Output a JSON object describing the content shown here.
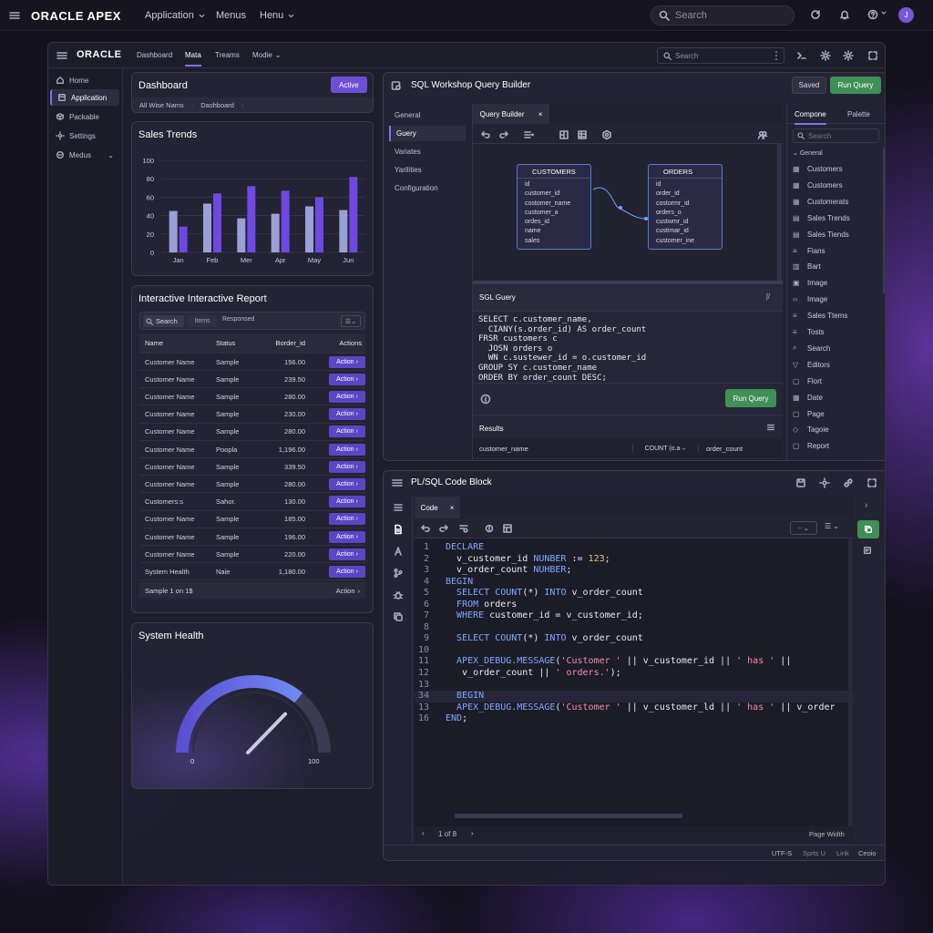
{
  "topbar": {
    "brand": "ORACLE APEX",
    "menus": [
      "Application",
      "Menus",
      "Henu"
    ],
    "search_placeholder": "Search",
    "avatar": "J"
  },
  "frame_header": {
    "brand": "ORACLE",
    "links": [
      "Dashboard",
      "Mata",
      "Treams",
      "Modie"
    ],
    "active_link": "Mata",
    "search_placeholder": "Search"
  },
  "sidebar": {
    "items": [
      {
        "label": "Home",
        "icon": "home-icon"
      },
      {
        "label": "Application",
        "icon": "app-icon"
      },
      {
        "label": "Packable",
        "icon": "package-icon"
      },
      {
        "label": "Settings",
        "icon": "gear-icon"
      },
      {
        "label": "Medus",
        "icon": "menu-icon"
      }
    ],
    "active": "Application"
  },
  "dashboard": {
    "title": "Dashboard",
    "badge": "Active",
    "breadcrumb": [
      "All Wise Nams",
      "Dashboard"
    ]
  },
  "sales_trends": {
    "title": "Sales Trends"
  },
  "chart_data": {
    "type": "bar",
    "categories": [
      "Jan",
      "Feb",
      "Mer",
      "Apr",
      "May",
      "Jun"
    ],
    "series": [
      {
        "values": [
          45,
          53,
          37,
          42,
          50,
          46
        ],
        "color": "#9aa0d6"
      },
      {
        "values": [
          28,
          64,
          72,
          67,
          60,
          82
        ],
        "color": "#6e48e0"
      }
    ],
    "title": "Sales Trends",
    "xlabel": "",
    "ylabel": "",
    "ylim": [
      0,
      100
    ],
    "yticks": [
      0,
      20,
      40,
      60,
      80,
      100
    ],
    "grid": true
  },
  "report": {
    "title": "Interactive Interactive Report",
    "search_label": "Search",
    "tabs": [
      "Items",
      "Responsed"
    ],
    "columns": [
      "Name",
      "Status",
      "Border_id",
      "Actions"
    ],
    "rows": [
      [
        "Customer Name",
        "Sample",
        "156.00",
        "Action"
      ],
      [
        "Customer Name",
        "Sample",
        "239.50",
        "Action"
      ],
      [
        "Customer Name",
        "Sample",
        "280.00",
        "Action"
      ],
      [
        "Customer Name",
        "Sample",
        "230.00",
        "Action"
      ],
      [
        "Customer Name",
        "Sample",
        "280.00",
        "Action"
      ],
      [
        "Customer Name",
        "Poopla",
        "1,196.00",
        "Action"
      ],
      [
        "Customer Name",
        "Sample",
        "339.50",
        "Action"
      ],
      [
        "Customer Name",
        "Sample",
        "280.00",
        "Action"
      ],
      [
        "Customers:s",
        "Sahor.",
        "130.00",
        "Action"
      ],
      [
        "Customer Name",
        "Sample",
        "185.00",
        "Action"
      ],
      [
        "Customer Name",
        "Sample",
        "196.00",
        "Action"
      ],
      [
        "Customer Name",
        "Sample",
        "220.00",
        "Action"
      ],
      [
        "System Health",
        "Naie",
        "1,180.00",
        "Action"
      ]
    ],
    "footer_left": "Sample 1 on 1$",
    "footer_right": "Action"
  },
  "system_health": {
    "title": "System Health",
    "min": "0",
    "max": "100",
    "gauge_value": 0.72
  },
  "query_builder": {
    "title": "SQL Workshop Query Builder",
    "saved": "Saved",
    "run": "Run Query",
    "nav": [
      "General",
      "Guery",
      "Variates",
      "Yarilities",
      "Configuration"
    ],
    "active_nav": "Guery",
    "tab": "Query Builder",
    "table1": {
      "name": "CUSTOMERS",
      "fields": [
        "id",
        "customer_id",
        "costomer_name",
        "customer_a",
        "ordes_id",
        "name",
        "sales"
      ]
    },
    "table2": {
      "name": "ORDERS",
      "fields": [
        "id",
        "order_id",
        "costormr_id",
        "orders_o",
        "custwmr_id",
        "custimar_id",
        "customer_ine"
      ]
    },
    "sql_title": "SGL Guery",
    "sql": [
      "SELECT c.customer_name,",
      "  CIANY(s.order_id) AS order_count",
      "FRSR customers c",
      "  JOSN orders o",
      "  WN c.sustewer_id = o.customer_id",
      "GROUP SY c.customer_name",
      "ORDER BY order_count DESC;"
    ],
    "run2": "Run Query",
    "results_title": "Results",
    "results_cols": [
      "customer_name",
      "COUNT (o.a→",
      "order_count"
    ]
  },
  "components": {
    "tabs": [
      "Compone",
      "Palette"
    ],
    "search_placeholder": "Search",
    "group": "General",
    "items": [
      {
        "label": "Customers",
        "icon": "table-icon"
      },
      {
        "label": "Customers",
        "icon": "table-icon"
      },
      {
        "label": "Customerats",
        "icon": "table-icon"
      },
      {
        "label": "Sales Trends",
        "icon": "chart-icon"
      },
      {
        "label": "Sales Tiends",
        "icon": "chart-icon"
      },
      {
        "label": "Fians",
        "icon": "list-icon"
      },
      {
        "label": "Bart",
        "icon": "bar-icon"
      },
      {
        "label": "Image",
        "icon": "image-icon"
      },
      {
        "label": "Image",
        "icon": "code-icon"
      },
      {
        "label": "Sales Ttems",
        "icon": "list-icon"
      },
      {
        "label": "Tosts",
        "icon": "list-icon"
      },
      {
        "label": "Search",
        "icon": "search-icon"
      },
      {
        "label": "Editors",
        "icon": "filter-icon"
      },
      {
        "label": "Flort",
        "icon": "doc-icon"
      },
      {
        "label": "Date",
        "icon": "calendar-icon"
      },
      {
        "label": "Page",
        "icon": "page-icon"
      },
      {
        "label": "Tagoie",
        "icon": "tag-icon"
      },
      {
        "label": "Report",
        "icon": "doc-icon"
      }
    ]
  },
  "plsql": {
    "title": "PL/SQL Code Block",
    "tab": "Code",
    "lines": [
      [
        "1",
        "DECLARE"
      ],
      [
        "2",
        "  v_customer_id NUNBER := 123;"
      ],
      [
        "3",
        "  v_order_count NUHBER;"
      ],
      [
        "4",
        "BEGIN"
      ],
      [
        "5",
        "  SELECT COUNT(*) INTO v_order_count"
      ],
      [
        "6",
        "  FROM orders"
      ],
      [
        "7",
        "  WHERE customer_id = v_customer_id;"
      ],
      [
        "8",
        ""
      ],
      [
        "9",
        "  SELECT COUNT(*) INTO v_order_count"
      ],
      [
        "10",
        ""
      ],
      [
        "11",
        "  APEX_DEBUG.MESSAGE('Customer ' || v_customer_id || ' has ' ||"
      ],
      [
        "12",
        "   v_order_count || ' orders.');"
      ],
      [
        "13",
        ""
      ],
      [
        "34",
        "  BEGIN"
      ],
      [
        "13",
        "  APEX_DEBUG.MESSAGE('Customer ' || v_customer_ld || ' has ' || v_order"
      ],
      [
        "16",
        "END;"
      ]
    ],
    "pager": "1 of 8",
    "page_width": "Page Width",
    "status": [
      "UTF-S",
      "Sprts U",
      "Link",
      "Ceoio"
    ]
  }
}
